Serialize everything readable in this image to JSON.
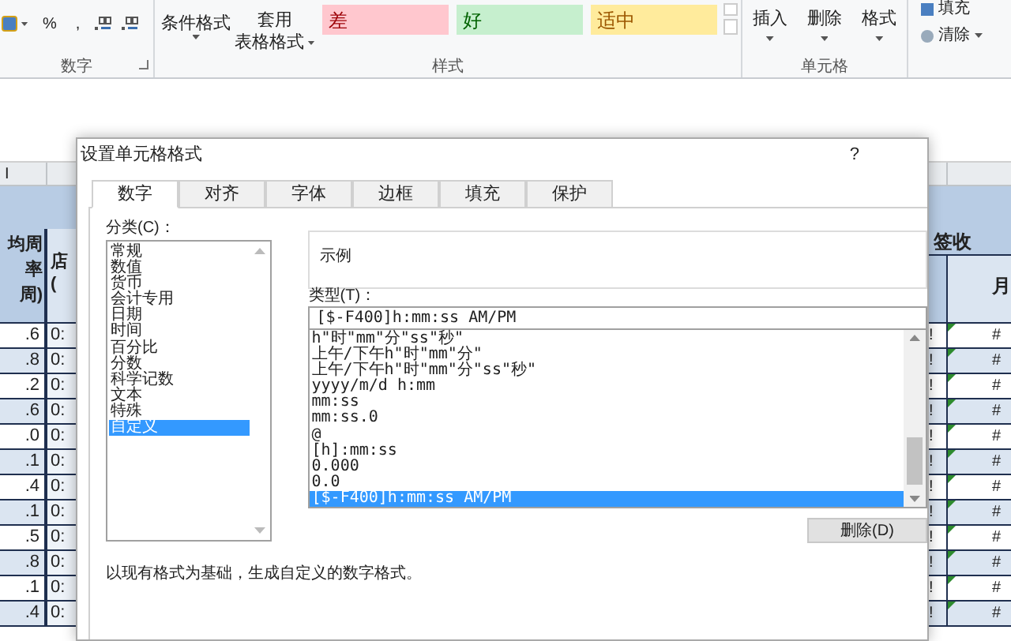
{
  "ribbon": {
    "number_group": {
      "label": "数字",
      "symbols": [
        "%",
        ","
      ]
    },
    "styles_group": {
      "label": "样式",
      "buttons": [
        {
          "lines": [
            "条件格式"
          ]
        },
        {
          "lines": [
            "套用",
            "表格格式"
          ]
        }
      ],
      "cell_styles": [
        {
          "label": "差",
          "kind": "bad",
          "color": "#ffc7ce"
        },
        {
          "label": "好",
          "kind": "good",
          "color": "#c6efce"
        },
        {
          "label": "适中",
          "kind": "neutral",
          "color": "#ffeb9c"
        }
      ]
    },
    "cells_group": {
      "label": "单元格",
      "buttons": [
        "插入",
        "删除",
        "格式"
      ]
    },
    "editing_group": {
      "buttons": [
        "填充",
        "清除"
      ]
    }
  },
  "sheet": {
    "left": {
      "column_header": "I",
      "header_1": [
        "均周",
        "率",
        "周)"
      ],
      "header_2": [
        "店",
        "("
      ],
      "rows": [
        {
          "column_1": ".6",
          "column_2": "0:"
        },
        {
          "column_1": ".8",
          "column_2": "0:"
        },
        {
          "column_1": ".2",
          "column_2": "0:"
        },
        {
          "column_1": ".6",
          "column_2": "0:"
        },
        {
          "column_1": ".0",
          "column_2": "0:"
        },
        {
          "column_1": ".1",
          "column_2": "0:"
        },
        {
          "column_1": ".4",
          "column_2": "0:"
        },
        {
          "column_1": ".1",
          "column_2": "0:"
        },
        {
          "column_1": ".5",
          "column_2": "0:"
        },
        {
          "column_1": ".8",
          "column_2": "0:"
        },
        {
          "column_1": ".1",
          "column_2": "0:"
        },
        {
          "column_1": ".4",
          "column_2": "0:"
        }
      ]
    },
    "right": {
      "band": "签收",
      "header": "月",
      "rows": [
        {
          "column_1": "!",
          "column_2": "#"
        },
        {
          "column_1": "!",
          "column_2": "#"
        },
        {
          "column_1": "!",
          "column_2": "#"
        },
        {
          "column_1": "!",
          "column_2": "#"
        },
        {
          "column_1": "!",
          "column_2": "#"
        },
        {
          "column_1": "!",
          "column_2": "#"
        },
        {
          "column_1": "!",
          "column_2": "#"
        },
        {
          "column_1": "!",
          "column_2": "#"
        },
        {
          "column_1": "!",
          "column_2": "#"
        },
        {
          "column_1": "!",
          "column_2": "#"
        },
        {
          "column_1": "!",
          "column_2": "#"
        },
        {
          "column_1": "!",
          "column_2": "#"
        }
      ]
    }
  },
  "dialog": {
    "title": "设置单元格格式",
    "help": "?",
    "tabs": [
      {
        "label": "数字",
        "selected": true
      },
      {
        "label": "对齐",
        "selected": false
      },
      {
        "label": "字体",
        "selected": false
      },
      {
        "label": "边框",
        "selected": false
      },
      {
        "label": "填充",
        "selected": false
      },
      {
        "label": "保护",
        "selected": false
      }
    ],
    "category_label": "分类(C)：",
    "categories": [
      {
        "label": "常规",
        "selected": false
      },
      {
        "label": "数值",
        "selected": false
      },
      {
        "label": "货币",
        "selected": false
      },
      {
        "label": "会计专用",
        "selected": false
      },
      {
        "label": "日期",
        "selected": false
      },
      {
        "label": "时间",
        "selected": false
      },
      {
        "label": "百分比",
        "selected": false
      },
      {
        "label": "分数",
        "selected": false
      },
      {
        "label": "科学记数",
        "selected": false
      },
      {
        "label": "文本",
        "selected": false
      },
      {
        "label": "特殊",
        "selected": false
      },
      {
        "label": "自定义",
        "selected": true
      }
    ],
    "sample_label": "示例",
    "type_label": "类型(T)：",
    "type_value": "[$-F400]h:mm:ss AM/PM",
    "types": [
      {
        "label": "h\"时\"mm\"分\"ss\"秒\"",
        "selected": false
      },
      {
        "label": "上午/下午h\"时\"mm\"分\"",
        "selected": false
      },
      {
        "label": "上午/下午h\"时\"mm\"分\"ss\"秒\"",
        "selected": false
      },
      {
        "label": "yyyy/m/d h:mm",
        "selected": false
      },
      {
        "label": "mm:ss",
        "selected": false
      },
      {
        "label": "mm:ss.0",
        "selected": false
      },
      {
        "label": "@",
        "selected": false
      },
      {
        "label": "[h]:mm:ss",
        "selected": false
      },
      {
        "label": "0.000",
        "selected": false
      },
      {
        "label": "0.0",
        "selected": false
      },
      {
        "label": "[$-F400]h:mm:ss AM/PM",
        "selected": true
      }
    ],
    "delete_button": "删除(D)",
    "description": "以现有格式为基础，生成自定义的数字格式。"
  }
}
